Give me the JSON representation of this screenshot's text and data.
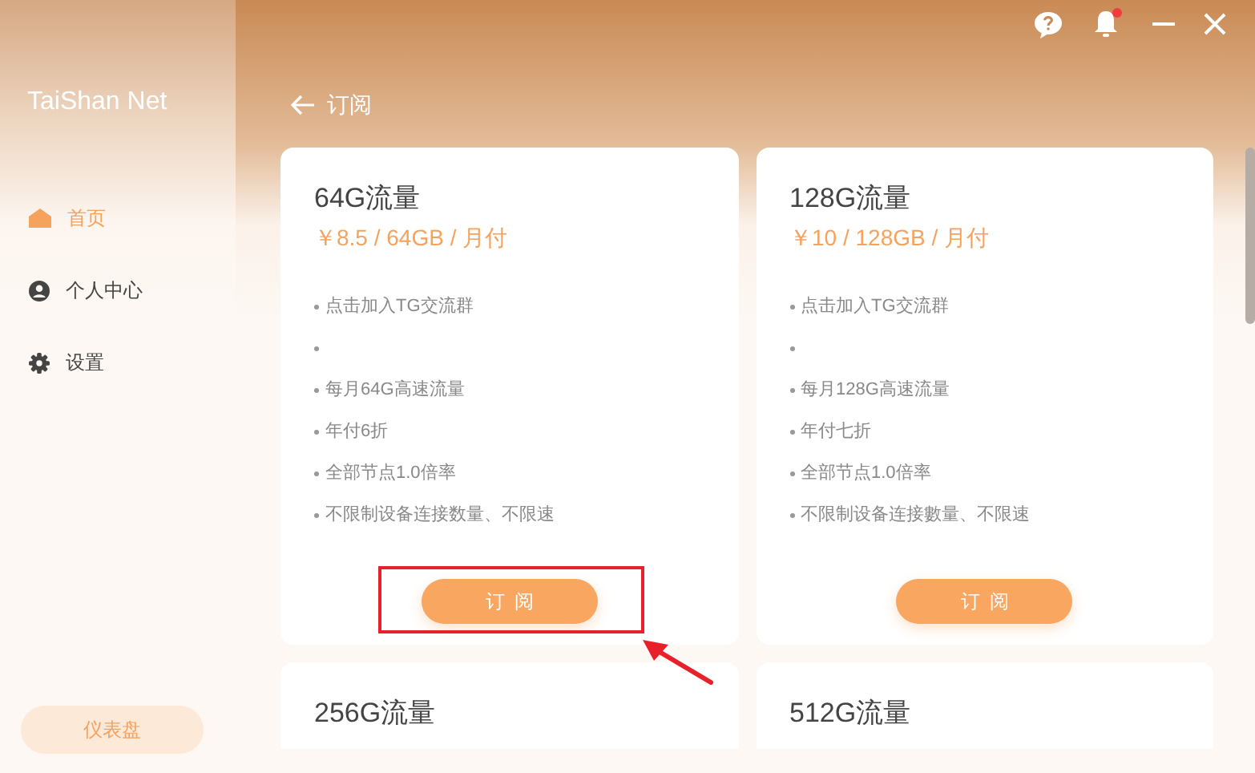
{
  "sidebar": {
    "brand": "TaiShan Net",
    "items": [
      {
        "label": "首页",
        "kind": "home",
        "selected": true
      },
      {
        "label": "个人中心",
        "kind": "profile",
        "selected": false
      },
      {
        "label": "设置",
        "kind": "settings",
        "selected": false
      }
    ],
    "dashboard_button": "仪表盘"
  },
  "titlebar": {
    "notification_unread": true
  },
  "page": {
    "back_label": "订阅"
  },
  "plans": [
    {
      "name": "64G流量",
      "price": "￥8.5 / 64GB / 月付",
      "features": [
        {
          "kind": "text",
          "text": "点击加入TG交流群"
        },
        {
          "kind": "empty"
        },
        {
          "kind": "text",
          "text": "每月64G高速流量"
        },
        {
          "kind": "text",
          "text": "年付6折"
        },
        {
          "kind": "text",
          "text": "全部节点1.0倍率"
        },
        {
          "kind": "text",
          "text": "不限制设备连接数量、不限速"
        }
      ],
      "button": "订阅",
      "highlighted": true
    },
    {
      "name": "128G流量",
      "price": "￥10 / 128GB / 月付",
      "features": [
        {
          "kind": "text",
          "text": "点击加入TG交流群"
        },
        {
          "kind": "empty"
        },
        {
          "kind": "text",
          "text": "每月128G高速流量"
        },
        {
          "kind": "text",
          "text": "年付七折"
        },
        {
          "kind": "text",
          "text": "全部节点1.0倍率"
        },
        {
          "kind": "text",
          "text": "不限制设备连接數量、不限速"
        }
      ],
      "button": "订阅",
      "highlighted": false
    },
    {
      "name": "256G流量"
    },
    {
      "name": "512G流量"
    }
  ]
}
